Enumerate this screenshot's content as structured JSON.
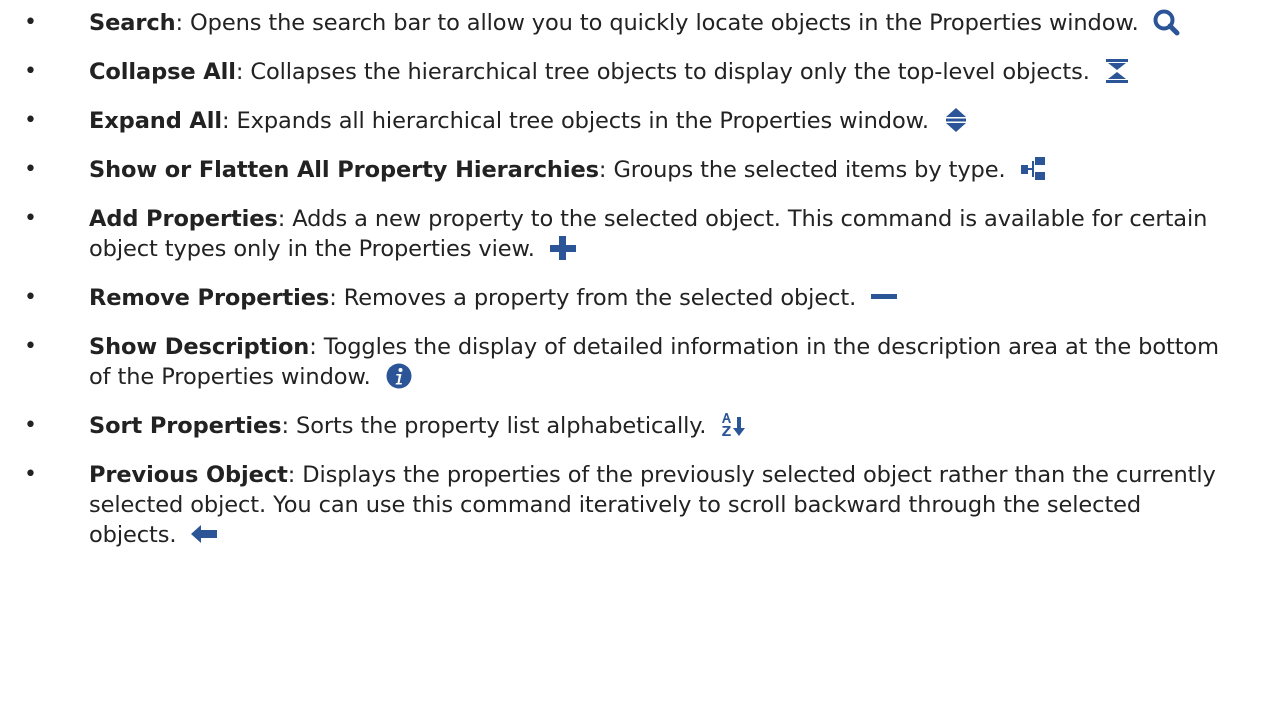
{
  "icon_color": "#2b5597",
  "items": [
    {
      "term": "Search",
      "desc": ": Opens the search bar to allow you to quickly locate objects in the Properties window.",
      "icon": "search-icon"
    },
    {
      "term": "Collapse All",
      "desc": ": Collapses the hierarchical tree objects to display only the top-level objects.",
      "icon": "collapse-all-icon"
    },
    {
      "term": "Expand All",
      "desc": ": Expands all hierarchical tree objects in the Properties window.",
      "icon": "expand-all-icon"
    },
    {
      "term": "Show or Flatten All Property Hierarchies",
      "desc": ": Groups the selected items by type.",
      "icon": "hierarchy-icon"
    },
    {
      "term": "Add Properties",
      "desc": ": Adds a new property to the selected object. This command is available for certain object types only in the Properties view.",
      "icon": "plus-icon"
    },
    {
      "term": "Remove Properties",
      "desc": ": Removes a property from the selected object.",
      "icon": "minus-icon"
    },
    {
      "term": "Show Description",
      "desc": ": Toggles the display of detailed information in the description area at the bottom of the Properties window.",
      "icon": "info-icon"
    },
    {
      "term": "Sort Properties",
      "desc": ": Sorts the property list alphabetically.",
      "icon": "sort-alphabetical-icon"
    },
    {
      "term": "Previous Object",
      "desc": ": Displays the properties of the previously selected object rather than the currently selected object. You can use this command iteratively to scroll backward through the selected objects.",
      "icon": "back-arrow-icon"
    }
  ]
}
